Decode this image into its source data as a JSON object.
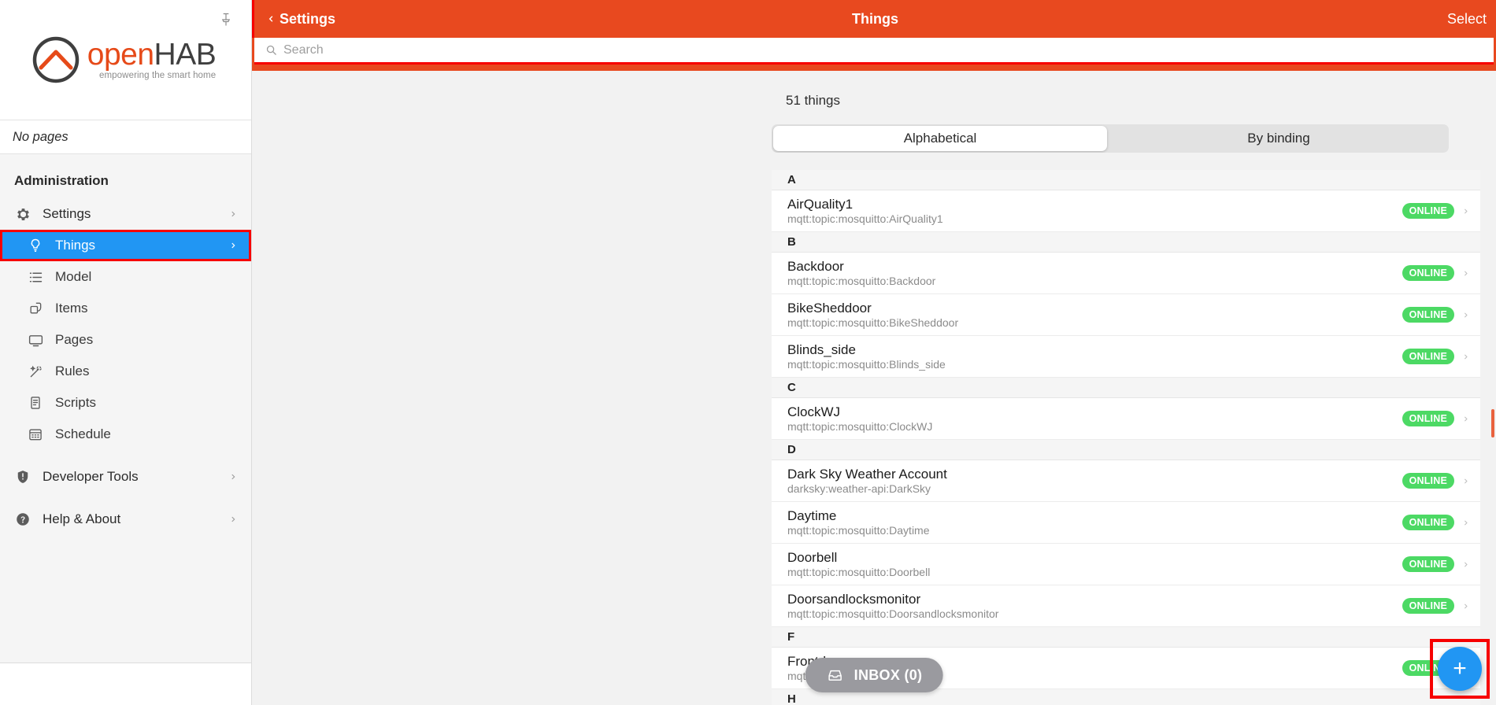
{
  "sidebar": {
    "logo": {
      "open": "open",
      "hab": "HAB",
      "tagline": "empowering the smart home"
    },
    "pin_icon": "pin-icon",
    "no_pages": "No pages",
    "section_title": "Administration",
    "items": [
      {
        "label": "Settings",
        "icon": "gear-icon",
        "level": "top",
        "chevron": true,
        "active": false
      },
      {
        "label": "Things",
        "icon": "lightbulb-icon",
        "level": "sub",
        "chevron": true,
        "active": true
      },
      {
        "label": "Model",
        "icon": "model-list-icon",
        "level": "sub",
        "chevron": false,
        "active": false
      },
      {
        "label": "Items",
        "icon": "items-stack-icon",
        "level": "sub",
        "chevron": false,
        "active": false
      },
      {
        "label": "Pages",
        "icon": "monitor-icon",
        "level": "sub",
        "chevron": false,
        "active": false
      },
      {
        "label": "Rules",
        "icon": "magic-wand-icon",
        "level": "sub",
        "chevron": false,
        "active": false
      },
      {
        "label": "Scripts",
        "icon": "script-document-icon",
        "level": "sub",
        "chevron": false,
        "active": false
      },
      {
        "label": "Schedule",
        "icon": "calendar-icon",
        "level": "sub",
        "chevron": false,
        "active": false
      },
      {
        "label": "Developer Tools",
        "icon": "shield-alert-icon",
        "level": "top",
        "chevron": true,
        "active": false
      },
      {
        "label": "Help & About",
        "icon": "question-circle-icon",
        "level": "top",
        "chevron": true,
        "active": false
      }
    ]
  },
  "topbar": {
    "back_label": "Settings",
    "back_icon": "chevron-left-icon",
    "title": "Things",
    "select_label": "Select",
    "accent_color": "#e8491f",
    "highlight_color": "#f70000"
  },
  "search": {
    "placeholder": "Search",
    "value": "",
    "icon": "search-icon"
  },
  "main": {
    "things_count": "51 things",
    "tabs": [
      {
        "label": "Alphabetical",
        "active": true
      },
      {
        "label": "By binding",
        "active": false
      }
    ],
    "groups": [
      {
        "letter": "A",
        "things": [
          {
            "name": "AirQuality1",
            "uid": "mqtt:topic:mosquitto:AirQuality1",
            "status": "ONLINE"
          }
        ]
      },
      {
        "letter": "B",
        "things": [
          {
            "name": "Backdoor",
            "uid": "mqtt:topic:mosquitto:Backdoor",
            "status": "ONLINE"
          },
          {
            "name": "BikeSheddoor",
            "uid": "mqtt:topic:mosquitto:BikeSheddoor",
            "status": "ONLINE"
          },
          {
            "name": "Blinds_side",
            "uid": "mqtt:topic:mosquitto:Blinds_side",
            "status": "ONLINE"
          }
        ]
      },
      {
        "letter": "C",
        "things": [
          {
            "name": "ClockWJ",
            "uid": "mqtt:topic:mosquitto:ClockWJ",
            "status": "ONLINE"
          }
        ]
      },
      {
        "letter": "D",
        "things": [
          {
            "name": "Dark Sky Weather Account",
            "uid": "darksky:weather-api:DarkSky",
            "status": "ONLINE"
          },
          {
            "name": "Daytime",
            "uid": "mqtt:topic:mosquitto:Daytime",
            "status": "ONLINE"
          },
          {
            "name": "Doorbell",
            "uid": "mqtt:topic:mosquitto:Doorbell",
            "status": "ONLINE"
          },
          {
            "name": "Doorsandlocksmonitor",
            "uid": "mqtt:topic:mosquitto:Doorsandlocksmonitor",
            "status": "ONLINE"
          }
        ]
      },
      {
        "letter": "F",
        "things": [
          {
            "name": "Frontdoor",
            "uid": "mqtt:topic:mosquitto:Frontdoor",
            "status": "ONLINE"
          }
        ]
      },
      {
        "letter": "H",
        "things": []
      }
    ],
    "status_color": "#4cd964"
  },
  "inbox": {
    "label": "INBOX (0)",
    "icon": "inbox-tray-icon"
  },
  "fab": {
    "icon": "plus-icon",
    "label": "+",
    "color": "#2196f3"
  }
}
